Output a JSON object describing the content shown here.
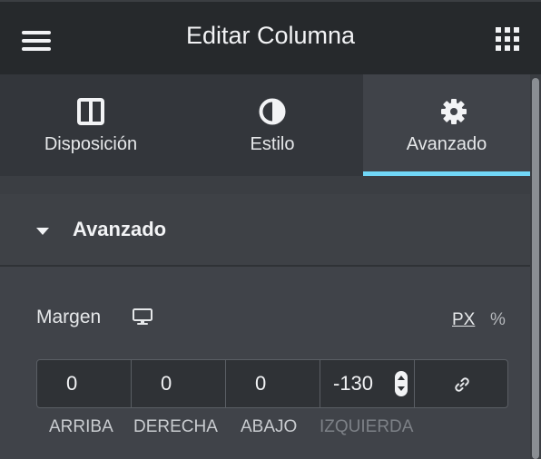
{
  "header": {
    "title": "Editar Columna"
  },
  "tabs": [
    {
      "label": "Disposición",
      "icon": "layout-columns-icon",
      "active": false
    },
    {
      "label": "Estilo",
      "icon": "half-circle-icon",
      "active": false
    },
    {
      "label": "Avanzado",
      "icon": "gear-icon",
      "active": true
    }
  ],
  "section": {
    "title": "Avanzado",
    "expanded": true
  },
  "margin": {
    "label": "Margen",
    "units": {
      "px": "PX",
      "percent": "%"
    },
    "selected_unit": "PX",
    "fields": [
      {
        "value": "0",
        "label": "ARRIBA"
      },
      {
        "value": "0",
        "label": "DERECHA"
      },
      {
        "value": "0",
        "label": "ABAJO"
      },
      {
        "value": "-130",
        "label": "IZQUIERDA"
      }
    ],
    "linked": false
  },
  "colors": {
    "accent": "#71d7f7",
    "header_bg": "#26292c",
    "panel_bg": "#404349"
  }
}
